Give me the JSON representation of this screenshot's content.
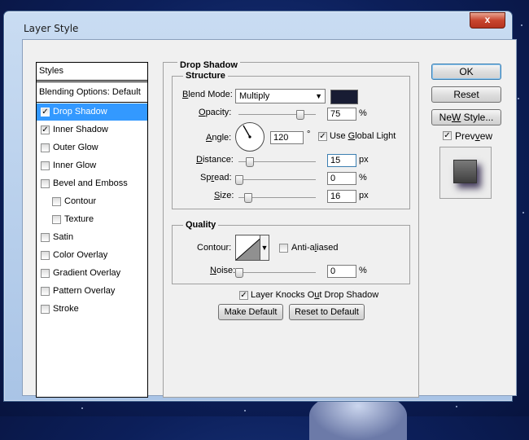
{
  "window": {
    "title": "Layer Style",
    "close": "x"
  },
  "sidebar": {
    "header": "Styles",
    "blending": "Blending Options: Default",
    "items": [
      {
        "label": "Drop Shadow",
        "checked": true,
        "selected": true,
        "indent": false
      },
      {
        "label": "Inner Shadow",
        "checked": true,
        "selected": false,
        "indent": false
      },
      {
        "label": "Outer Glow",
        "checked": false,
        "selected": false,
        "indent": false
      },
      {
        "label": "Inner Glow",
        "checked": false,
        "selected": false,
        "indent": false
      },
      {
        "label": "Bevel and Emboss",
        "checked": false,
        "selected": false,
        "indent": false
      },
      {
        "label": "Contour",
        "checked": false,
        "selected": false,
        "indent": true
      },
      {
        "label": "Texture",
        "checked": false,
        "selected": false,
        "indent": true
      },
      {
        "label": "Satin",
        "checked": false,
        "selected": false,
        "indent": false
      },
      {
        "label": "Color Overlay",
        "checked": false,
        "selected": false,
        "indent": false
      },
      {
        "label": "Gradient Overlay",
        "checked": false,
        "selected": false,
        "indent": false
      },
      {
        "label": "Pattern Overlay",
        "checked": false,
        "selected": false,
        "indent": false
      },
      {
        "label": "Stroke",
        "checked": false,
        "selected": false,
        "indent": false
      }
    ]
  },
  "drop_shadow": {
    "section_title": "Drop Shadow",
    "structure": {
      "title": "Structure",
      "blend_mode_label": "Blend Mode:",
      "blend_mode_value": "Multiply",
      "shadow_color": "#181c33",
      "opacity_label": "Opacity:",
      "opacity_value": "75",
      "opacity_unit": "%",
      "angle_label": "Angle:",
      "angle_value": "120",
      "angle_unit": "°",
      "global_light_label": "Use Global Light",
      "global_light_checked": true,
      "distance_label": "Distance:",
      "distance_value": "15",
      "distance_unit": "px",
      "spread_label": "Spread:",
      "spread_value": "0",
      "spread_unit": "%",
      "size_label": "Size:",
      "size_value": "16",
      "size_unit": "px"
    },
    "quality": {
      "title": "Quality",
      "contour_label": "Contour:",
      "anti_aliased_label": "Anti-aliased",
      "anti_aliased_checked": false,
      "noise_label": "Noise:",
      "noise_value": "0",
      "noise_unit": "%"
    },
    "knocks_out_label": "Layer Knocks Out Drop Shadow",
    "knocks_out_checked": true,
    "make_default": "Make Default",
    "reset_default": "Reset to Default"
  },
  "actions": {
    "ok": "OK",
    "reset": "Reset",
    "new_style": "New Style...",
    "preview_label": "Preview",
    "preview_checked": true
  }
}
